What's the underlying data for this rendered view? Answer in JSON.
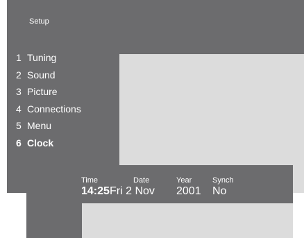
{
  "setup": {
    "title": "Setup",
    "menu": [
      {
        "number": "1",
        "label": "Tuning",
        "active": false
      },
      {
        "number": "2",
        "label": "Sound",
        "active": false
      },
      {
        "number": "3",
        "label": "Picture",
        "active": false
      },
      {
        "number": "4",
        "label": "Connections",
        "active": false
      },
      {
        "number": "5",
        "label": "Menu",
        "active": false
      },
      {
        "number": "6",
        "label": "Clock",
        "active": true
      }
    ]
  },
  "clock": {
    "time_label": "Time",
    "time_value": "14:25",
    "date_label": "Date",
    "date_value": "Fri 2 Nov",
    "year_label": "Year",
    "year_value": "2001",
    "synch_label": "Synch",
    "synch_value": "No"
  },
  "colors": {
    "panel_bg": "#6c6c6e",
    "content_bg": "#dcdcdc",
    "text": "#ffffff"
  }
}
